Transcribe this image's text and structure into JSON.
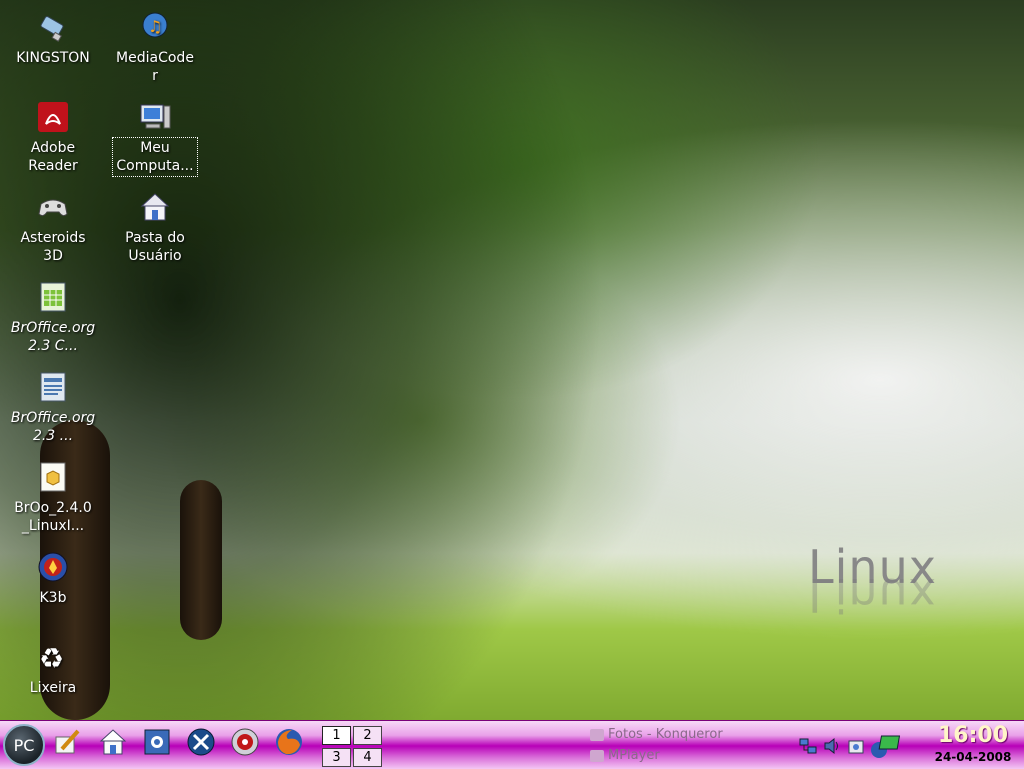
{
  "desktop": {
    "icons": [
      {
        "label": "KINGSTON",
        "icon": "usb-drive-icon"
      },
      {
        "label": "MediaCoder",
        "icon": "mediacoder-icon"
      },
      {
        "label": "Adobe Reader",
        "icon": "adobe-reader-icon"
      },
      {
        "label": "Meu Computa...",
        "icon": "computer-icon"
      },
      {
        "label": "Asteroids 3D",
        "icon": "gamepad-icon"
      },
      {
        "label": "Pasta do Usuário",
        "icon": "home-folder-icon"
      },
      {
        "label": "BrOffice.org 2.3 C...",
        "icon": "spreadsheet-icon"
      },
      {
        "label": "BrOffice.org 2.3 ...",
        "icon": "writer-document-icon"
      },
      {
        "label": "BrOo_2.4.0_LinuxI...",
        "icon": "package-icon"
      },
      {
        "label": "K3b",
        "icon": "k3b-icon"
      },
      {
        "label": "Lixeira",
        "icon": "trash-icon"
      }
    ],
    "wallpaper_text": "Linux"
  },
  "taskbar": {
    "start_label": "PC",
    "quick_launch": [
      "edit-icon",
      "home-icon",
      "control-center-icon",
      "tools-icon",
      "media-disc-icon",
      "firefox-icon"
    ],
    "pager": [
      "1",
      "2",
      "3",
      "4"
    ],
    "active_desktop": "1",
    "tasks": [
      {
        "label": "Fotos - Konqueror"
      },
      {
        "label": "MPlayer"
      }
    ],
    "tray": [
      "network-icon",
      "volume-icon",
      "camera-icon",
      "display-icon"
    ],
    "clock": {
      "time": "16:00",
      "date": "24-04-2008"
    }
  },
  "colors": {
    "taskbar_accent": "#b800b8",
    "clock_text": "#fff6c8"
  }
}
